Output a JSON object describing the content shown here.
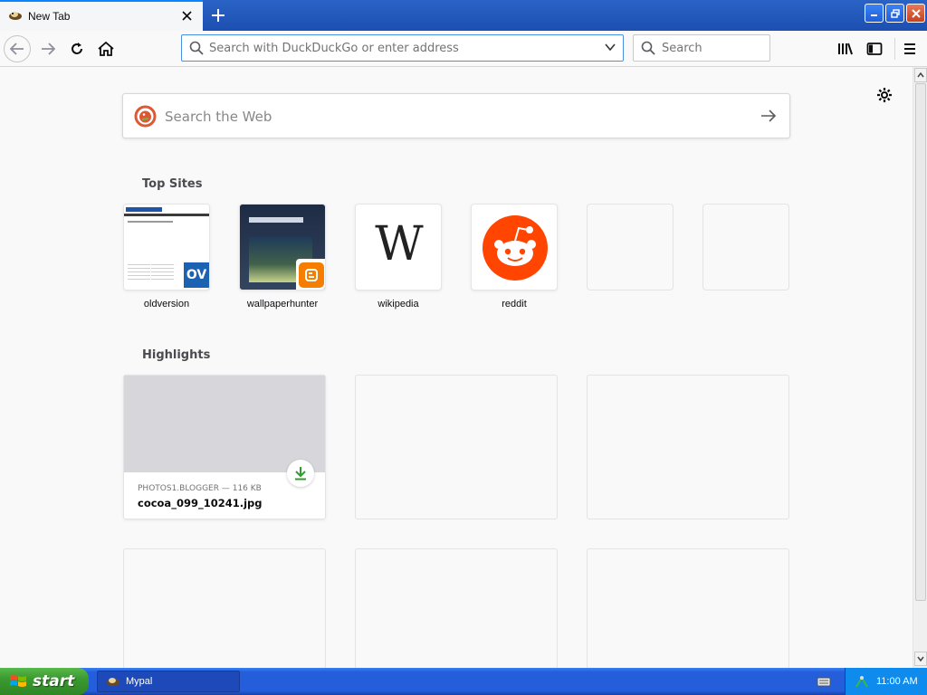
{
  "browser": {
    "tab": {
      "title": "New Tab"
    },
    "urlbar": {
      "placeholder": "Search with DuckDuckGo or enter address"
    },
    "searchbar": {
      "placeholder": "Search"
    }
  },
  "newtab": {
    "web_search": {
      "placeholder": "Search the Web"
    },
    "top_sites": {
      "title": "Top Sites",
      "sites": [
        {
          "label": "oldversion"
        },
        {
          "label": "wallpaperhunter"
        },
        {
          "label": "wikipedia",
          "glyph": "W"
        },
        {
          "label": "reddit"
        },
        {
          "label": ""
        },
        {
          "label": ""
        }
      ]
    },
    "highlights": {
      "title": "Highlights",
      "cards": [
        {
          "source": "PHOTOS1.BLOGGER — 116 KB",
          "title": "cocoa_099_10241.jpg"
        }
      ]
    }
  },
  "taskbar": {
    "start_label": "start",
    "task_label": "Mypal",
    "time": "11:00 AM"
  },
  "colors": {
    "accent": "#0a84ff",
    "reddit": "#ff4500",
    "blogger": "#f57d00",
    "download_green": "#2e9c2e"
  }
}
